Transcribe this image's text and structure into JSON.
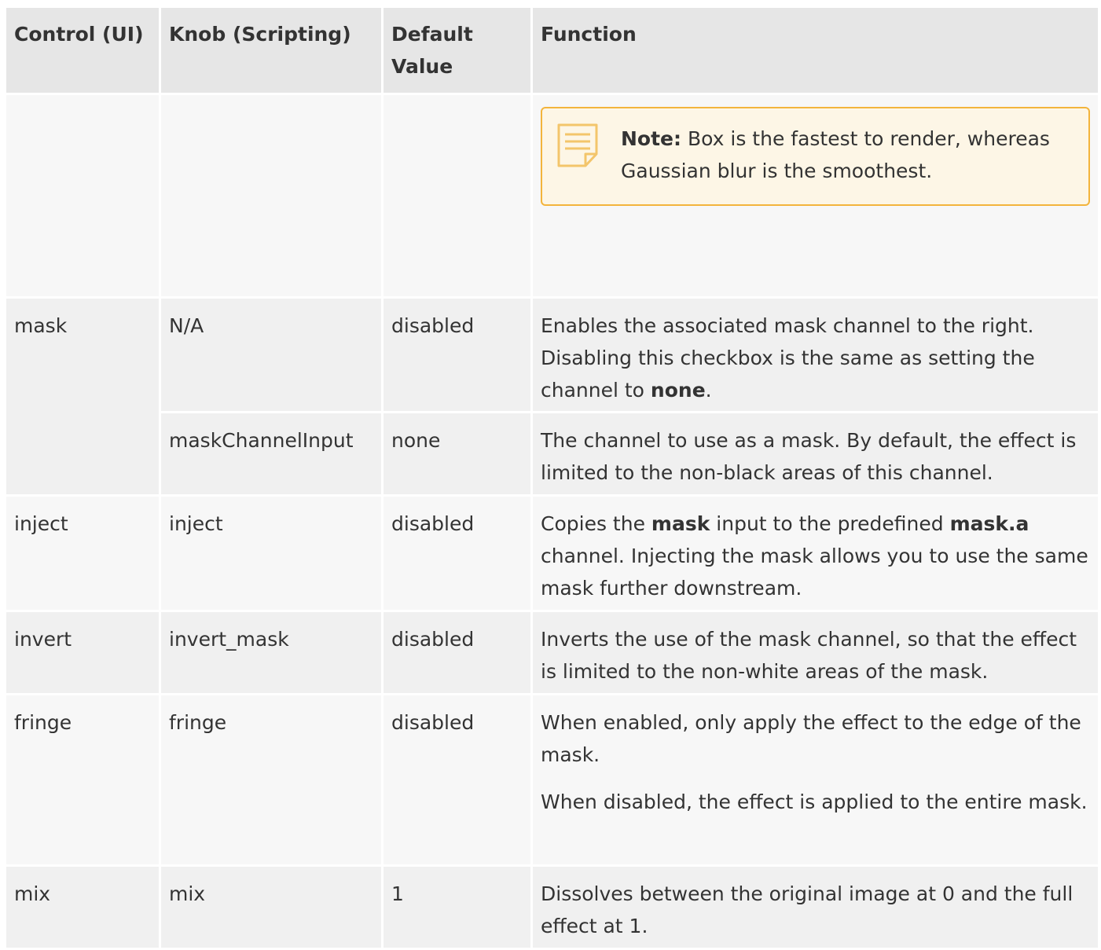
{
  "table": {
    "headers": [
      "Control (UI)",
      "Knob (Scripting)",
      "Default Value",
      "Function"
    ],
    "note": {
      "label": "Note:",
      "text": "Box is the fastest to render, whereas Gaussian blur is the smoothest."
    },
    "rows": [
      {
        "control": "mask",
        "knob": "N/A",
        "default": "disabled",
        "func": {
          "pre": "Enables the associated mask channel to the right. Disabling this checkbox is the same as setting the channel to ",
          "bold": "none",
          "post": "."
        }
      },
      {
        "knob": "maskChannelInput",
        "default": "none",
        "func": "The channel to use as a mask. By default, the effect is limited to the non-black areas of this channel."
      },
      {
        "control": "inject",
        "knob": "inject",
        "default": "disabled",
        "func": {
          "pre": "Copies the ",
          "bold1": "mask",
          "mid": " input to the predefined ",
          "bold2": "mask.a",
          "post": " channel. Injecting the mask allows you to use the same mask further downstream."
        }
      },
      {
        "control": "invert",
        "knob": "invert_mask",
        "default": "disabled",
        "func": "Inverts the use of the mask channel, so that the effect is limited to the non-white areas of the mask."
      },
      {
        "control": "fringe",
        "knob": "fringe",
        "default": "disabled",
        "func1": "When enabled, only apply the effect to the edge of the mask.",
        "func2": "When disabled, the effect is applied to the entire mask."
      },
      {
        "control": "mix",
        "knob": "mix",
        "default": "1",
        "func": "Dissolves between the original image at 0 and the full effect at 1."
      }
    ]
  },
  "colors": {
    "header_bg": "#e6e6e6",
    "row_bg_a": "#f0f0f0",
    "row_bg_b": "#f7f7f7",
    "note_border": "#f3b43c",
    "note_bg": "#fdf6e6",
    "text": "#333333"
  },
  "icons": {
    "note": "note-paper-icon"
  }
}
